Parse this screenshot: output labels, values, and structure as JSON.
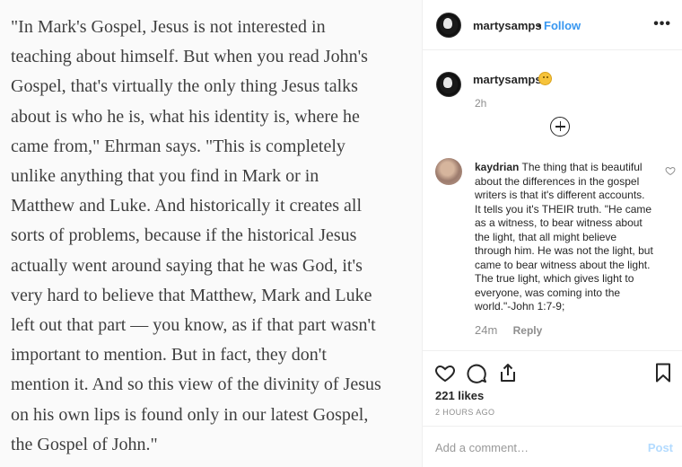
{
  "quote": {
    "lines": [
      "\"In Mark's Gospel, Jesus is not interested in",
      "teaching about himself. But when you read John's",
      "Gospel, that's virtually the only thing Jesus talks",
      "about is who he is, what his identity is, where he",
      "came from,\" Ehrman says. \"This is completely",
      "unlike anything that you find in Mark or in",
      "Matthew and Luke. And historically it creates all",
      "sorts of problems, because if the historical Jesus",
      "actually went around saying that he was God, it's",
      "very hard to believe that Matthew, Mark and Luke",
      "left out that part — you know, as if that part wasn't",
      "important to mention. But in fact, they don't",
      "mention it. And so this view of the divinity of Jesus",
      "on his own lips is found only in our latest Gospel,",
      "the Gospel of John.\""
    ]
  },
  "header": {
    "username": "martysamps",
    "separator": "•",
    "follow_label": "Follow",
    "more_label": "•••"
  },
  "caption": {
    "username": "martysamps",
    "time": "2h"
  },
  "comment": {
    "username": "kaydrian",
    "lines": [
      "The thing that is beautiful",
      "about the differences in the gospel",
      "writers is that it's different accounts.",
      "It tells you it's THEIR truth. \"He came",
      "as a witness, to bear witness about",
      "the light, that all might believe",
      "through him. He was not the light, but",
      "came to bear witness about the light.",
      "The true light, which gives light to",
      "everyone, was coming into the",
      "world.\"-John 1:7-9;"
    ],
    "time": "24m",
    "reply_label": "Reply"
  },
  "actions": {
    "likes": "221 likes",
    "posted_ago": "2 HOURS AGO"
  },
  "add_comment": {
    "placeholder": "Add a comment…",
    "post_label": "Post"
  },
  "colors": {
    "link": "#3897f0",
    "post_disabled": "#b3dbff",
    "secondary_text": "#8e8e8e"
  },
  "icons": [
    "heart-icon",
    "comment-icon",
    "share-icon",
    "bookmark-icon",
    "more-icon",
    "add-icon"
  ]
}
